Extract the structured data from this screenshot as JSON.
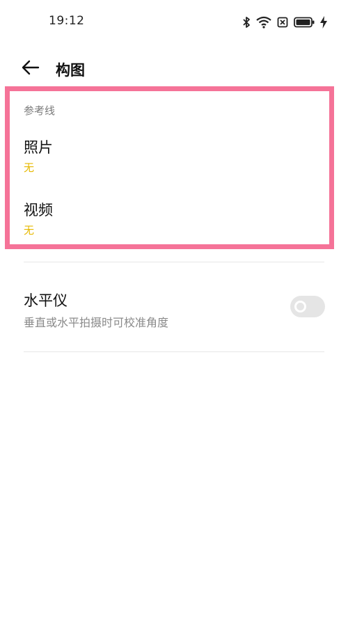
{
  "status_bar": {
    "time": "19:12",
    "icons": [
      "bluetooth-icon",
      "wifi-icon",
      "no-sim-icon",
      "battery-icon",
      "charging-icon"
    ]
  },
  "header": {
    "back_icon": "arrow-left-icon",
    "title": "构图"
  },
  "section": {
    "title": "参考线",
    "items": [
      {
        "label": "照片",
        "value": "无"
      },
      {
        "label": "视频",
        "value": "无"
      }
    ]
  },
  "level": {
    "label": "水平仪",
    "description": "垂直或水平拍摄时可校准角度",
    "enabled": false
  },
  "colors": {
    "accent_value": "#e6b800",
    "highlight_border": "#f57398",
    "toggle_off": "#e5e5e5"
  }
}
